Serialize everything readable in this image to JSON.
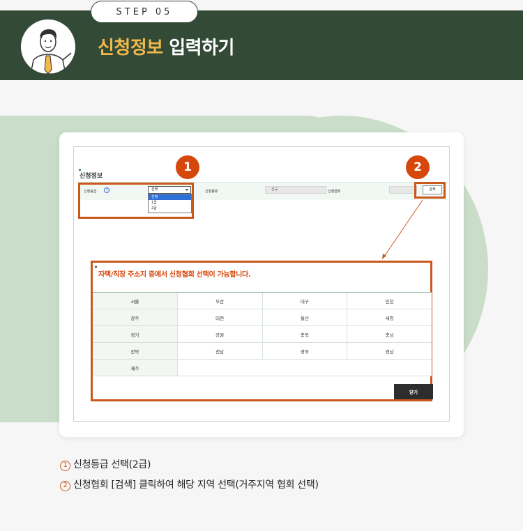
{
  "header": {
    "step_label": "STEP 05",
    "title_highlight": "신청정보",
    "title_rest": " 입력하기",
    "accent_color": "#f2b84b",
    "header_color": "#334a36"
  },
  "form": {
    "section_title": "신청정보",
    "grade_label": "신청등급",
    "grade_info_icon": "?",
    "grade_select_value": "선택",
    "grade_options": [
      "선택",
      "1급",
      "2급"
    ],
    "type_label": "신청종류",
    "type_value": "신규",
    "assoc_label": "신청협회",
    "search_button": "검색"
  },
  "markers": {
    "one": "1",
    "two": "2"
  },
  "popup": {
    "title": "자택/직장 주소지 중에서 신청협회 선택이 가능합니다.",
    "regions": [
      [
        "서울",
        "부산",
        "대구",
        "인천"
      ],
      [
        "광주",
        "대전",
        "울산",
        "세종"
      ],
      [
        "경기",
        "강원",
        "충북",
        "충남"
      ],
      [
        "전북",
        "전남",
        "경북",
        "경남"
      ],
      [
        "제주"
      ]
    ],
    "close_button": "닫기"
  },
  "notes": [
    {
      "num": "1",
      "text": "신청등급 선택(2급)"
    },
    {
      "num": "2",
      "text": "신청협회 [검색] 클릭하여 해당 지역 선택(거주지역 협회 선택)"
    }
  ]
}
